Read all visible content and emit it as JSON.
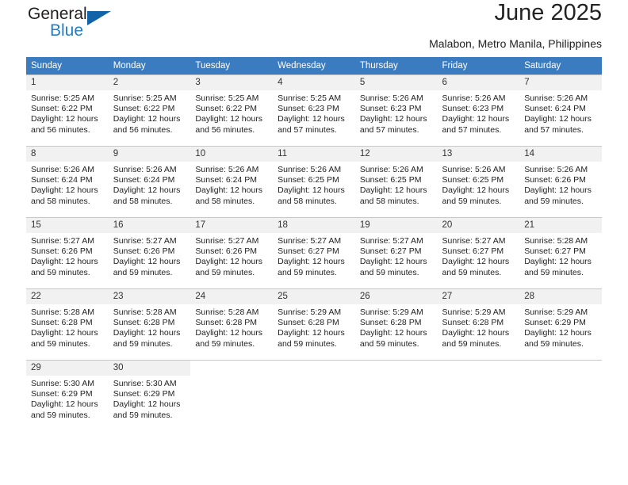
{
  "brand": {
    "name_part1": "General",
    "name_part2": "Blue",
    "triangle_color": "#1263a8",
    "blue_color": "#1f7fc4"
  },
  "header": {
    "title": "June 2025",
    "subtitle": "Malabon, Metro Manila, Philippines",
    "header_bg": "#3b7cc0",
    "header_text_color": "#ffffff"
  },
  "calendar": {
    "weekdays": [
      "Sunday",
      "Monday",
      "Tuesday",
      "Wednesday",
      "Thursday",
      "Friday",
      "Saturday"
    ],
    "weeks": [
      [
        {
          "day": "1",
          "sunrise": "Sunrise: 5:25 AM",
          "sunset": "Sunset: 6:22 PM",
          "daylight1": "Daylight: 12 hours",
          "daylight2": "and 56 minutes."
        },
        {
          "day": "2",
          "sunrise": "Sunrise: 5:25 AM",
          "sunset": "Sunset: 6:22 PM",
          "daylight1": "Daylight: 12 hours",
          "daylight2": "and 56 minutes."
        },
        {
          "day": "3",
          "sunrise": "Sunrise: 5:25 AM",
          "sunset": "Sunset: 6:22 PM",
          "daylight1": "Daylight: 12 hours",
          "daylight2": "and 56 minutes."
        },
        {
          "day": "4",
          "sunrise": "Sunrise: 5:25 AM",
          "sunset": "Sunset: 6:23 PM",
          "daylight1": "Daylight: 12 hours",
          "daylight2": "and 57 minutes."
        },
        {
          "day": "5",
          "sunrise": "Sunrise: 5:26 AM",
          "sunset": "Sunset: 6:23 PM",
          "daylight1": "Daylight: 12 hours",
          "daylight2": "and 57 minutes."
        },
        {
          "day": "6",
          "sunrise": "Sunrise: 5:26 AM",
          "sunset": "Sunset: 6:23 PM",
          "daylight1": "Daylight: 12 hours",
          "daylight2": "and 57 minutes."
        },
        {
          "day": "7",
          "sunrise": "Sunrise: 5:26 AM",
          "sunset": "Sunset: 6:24 PM",
          "daylight1": "Daylight: 12 hours",
          "daylight2": "and 57 minutes."
        }
      ],
      [
        {
          "day": "8",
          "sunrise": "Sunrise: 5:26 AM",
          "sunset": "Sunset: 6:24 PM",
          "daylight1": "Daylight: 12 hours",
          "daylight2": "and 58 minutes."
        },
        {
          "day": "9",
          "sunrise": "Sunrise: 5:26 AM",
          "sunset": "Sunset: 6:24 PM",
          "daylight1": "Daylight: 12 hours",
          "daylight2": "and 58 minutes."
        },
        {
          "day": "10",
          "sunrise": "Sunrise: 5:26 AM",
          "sunset": "Sunset: 6:24 PM",
          "daylight1": "Daylight: 12 hours",
          "daylight2": "and 58 minutes."
        },
        {
          "day": "11",
          "sunrise": "Sunrise: 5:26 AM",
          "sunset": "Sunset: 6:25 PM",
          "daylight1": "Daylight: 12 hours",
          "daylight2": "and 58 minutes."
        },
        {
          "day": "12",
          "sunrise": "Sunrise: 5:26 AM",
          "sunset": "Sunset: 6:25 PM",
          "daylight1": "Daylight: 12 hours",
          "daylight2": "and 58 minutes."
        },
        {
          "day": "13",
          "sunrise": "Sunrise: 5:26 AM",
          "sunset": "Sunset: 6:25 PM",
          "daylight1": "Daylight: 12 hours",
          "daylight2": "and 59 minutes."
        },
        {
          "day": "14",
          "sunrise": "Sunrise: 5:26 AM",
          "sunset": "Sunset: 6:26 PM",
          "daylight1": "Daylight: 12 hours",
          "daylight2": "and 59 minutes."
        }
      ],
      [
        {
          "day": "15",
          "sunrise": "Sunrise: 5:27 AM",
          "sunset": "Sunset: 6:26 PM",
          "daylight1": "Daylight: 12 hours",
          "daylight2": "and 59 minutes."
        },
        {
          "day": "16",
          "sunrise": "Sunrise: 5:27 AM",
          "sunset": "Sunset: 6:26 PM",
          "daylight1": "Daylight: 12 hours",
          "daylight2": "and 59 minutes."
        },
        {
          "day": "17",
          "sunrise": "Sunrise: 5:27 AM",
          "sunset": "Sunset: 6:26 PM",
          "daylight1": "Daylight: 12 hours",
          "daylight2": "and 59 minutes."
        },
        {
          "day": "18",
          "sunrise": "Sunrise: 5:27 AM",
          "sunset": "Sunset: 6:27 PM",
          "daylight1": "Daylight: 12 hours",
          "daylight2": "and 59 minutes."
        },
        {
          "day": "19",
          "sunrise": "Sunrise: 5:27 AM",
          "sunset": "Sunset: 6:27 PM",
          "daylight1": "Daylight: 12 hours",
          "daylight2": "and 59 minutes."
        },
        {
          "day": "20",
          "sunrise": "Sunrise: 5:27 AM",
          "sunset": "Sunset: 6:27 PM",
          "daylight1": "Daylight: 12 hours",
          "daylight2": "and 59 minutes."
        },
        {
          "day": "21",
          "sunrise": "Sunrise: 5:28 AM",
          "sunset": "Sunset: 6:27 PM",
          "daylight1": "Daylight: 12 hours",
          "daylight2": "and 59 minutes."
        }
      ],
      [
        {
          "day": "22",
          "sunrise": "Sunrise: 5:28 AM",
          "sunset": "Sunset: 6:28 PM",
          "daylight1": "Daylight: 12 hours",
          "daylight2": "and 59 minutes."
        },
        {
          "day": "23",
          "sunrise": "Sunrise: 5:28 AM",
          "sunset": "Sunset: 6:28 PM",
          "daylight1": "Daylight: 12 hours",
          "daylight2": "and 59 minutes."
        },
        {
          "day": "24",
          "sunrise": "Sunrise: 5:28 AM",
          "sunset": "Sunset: 6:28 PM",
          "daylight1": "Daylight: 12 hours",
          "daylight2": "and 59 minutes."
        },
        {
          "day": "25",
          "sunrise": "Sunrise: 5:29 AM",
          "sunset": "Sunset: 6:28 PM",
          "daylight1": "Daylight: 12 hours",
          "daylight2": "and 59 minutes."
        },
        {
          "day": "26",
          "sunrise": "Sunrise: 5:29 AM",
          "sunset": "Sunset: 6:28 PM",
          "daylight1": "Daylight: 12 hours",
          "daylight2": "and 59 minutes."
        },
        {
          "day": "27",
          "sunrise": "Sunrise: 5:29 AM",
          "sunset": "Sunset: 6:28 PM",
          "daylight1": "Daylight: 12 hours",
          "daylight2": "and 59 minutes."
        },
        {
          "day": "28",
          "sunrise": "Sunrise: 5:29 AM",
          "sunset": "Sunset: 6:29 PM",
          "daylight1": "Daylight: 12 hours",
          "daylight2": "and 59 minutes."
        }
      ],
      [
        {
          "day": "29",
          "sunrise": "Sunrise: 5:30 AM",
          "sunset": "Sunset: 6:29 PM",
          "daylight1": "Daylight: 12 hours",
          "daylight2": "and 59 minutes."
        },
        {
          "day": "30",
          "sunrise": "Sunrise: 5:30 AM",
          "sunset": "Sunset: 6:29 PM",
          "daylight1": "Daylight: 12 hours",
          "daylight2": "and 59 minutes."
        },
        {
          "day": "",
          "sunrise": "",
          "sunset": "",
          "daylight1": "",
          "daylight2": ""
        },
        {
          "day": "",
          "sunrise": "",
          "sunset": "",
          "daylight1": "",
          "daylight2": ""
        },
        {
          "day": "",
          "sunrise": "",
          "sunset": "",
          "daylight1": "",
          "daylight2": ""
        },
        {
          "day": "",
          "sunrise": "",
          "sunset": "",
          "daylight1": "",
          "daylight2": ""
        },
        {
          "day": "",
          "sunrise": "",
          "sunset": "",
          "daylight1": "",
          "daylight2": ""
        }
      ]
    ]
  }
}
